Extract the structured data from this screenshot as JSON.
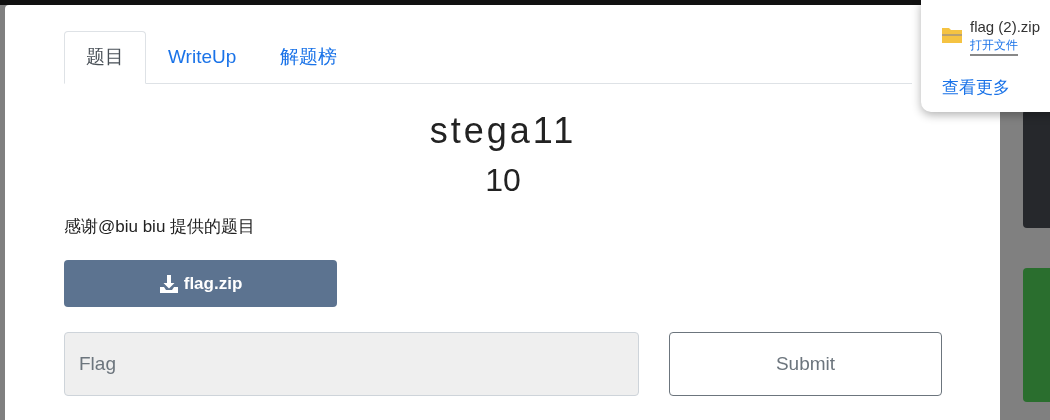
{
  "tabs": [
    {
      "label": "题目",
      "selected": true
    },
    {
      "label": "WriteUp",
      "selected": false
    },
    {
      "label": "解题榜",
      "selected": false
    }
  ],
  "challenge": {
    "title": "stega11",
    "points": "10",
    "description": "感谢@biu biu 提供的题目",
    "download_button": "flag.zip"
  },
  "flag_form": {
    "placeholder": "Flag",
    "submit_button": "Submit"
  },
  "downloads_popup": {
    "file_name": "flag (2).zip",
    "open_link": "打开文件",
    "more_link": "查看更多"
  }
}
